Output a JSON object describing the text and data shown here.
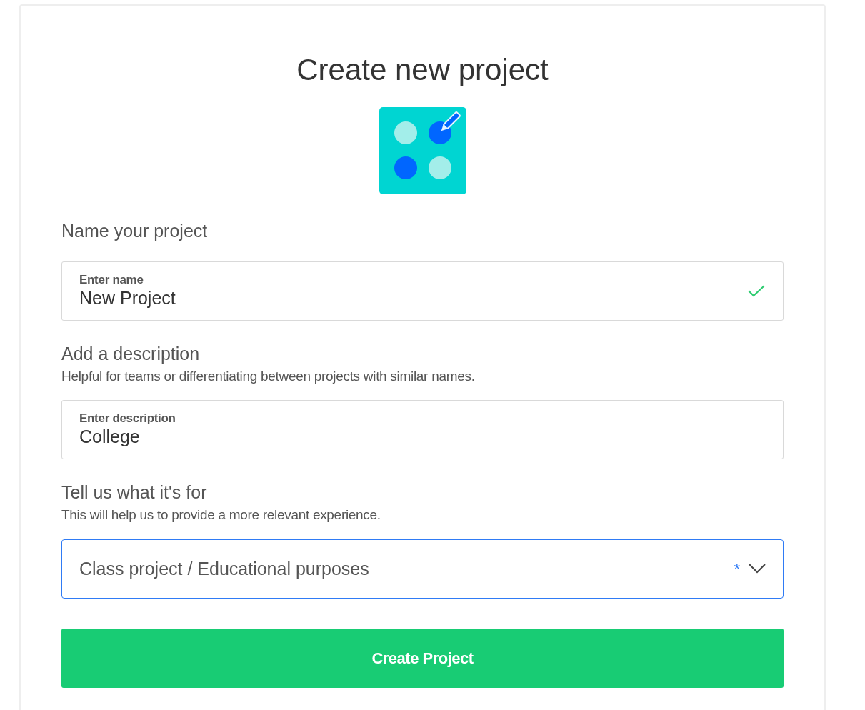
{
  "title": "Create new project",
  "name_section": {
    "heading": "Name your project",
    "field": {
      "label": "Enter name",
      "value": "New Project",
      "valid": true
    }
  },
  "description_section": {
    "heading": "Add a description",
    "helper": "Helpful for teams or differentiating between projects with similar names.",
    "field": {
      "label": "Enter description",
      "value": "College",
      "valid": false
    }
  },
  "purpose_section": {
    "heading": "Tell us what it's for",
    "helper": "This will help us to provide a more relevant experience.",
    "select": {
      "value": "Class project / Educational purposes",
      "required_mark": "*",
      "focused": true
    }
  },
  "submit": {
    "label": "Create Project"
  }
}
